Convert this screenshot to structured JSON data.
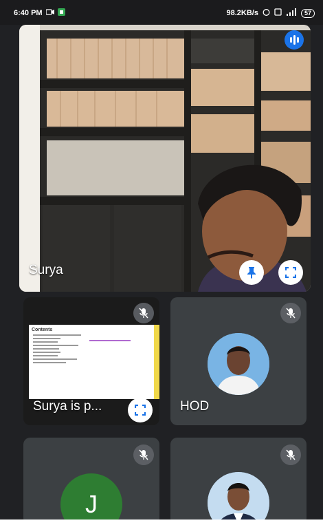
{
  "status_bar": {
    "time": "6:40 PM",
    "network_speed": "98.2KB/s",
    "battery": "57"
  },
  "main_speaker": {
    "name": "Surya"
  },
  "tiles": [
    {
      "name": "Surya is p...",
      "type": "presentation",
      "slide_title": "Contents"
    },
    {
      "name": "HOD",
      "type": "photo"
    },
    {
      "name": "",
      "type": "initial",
      "initial": "J",
      "color": "#2e7d32"
    },
    {
      "name": "",
      "type": "photo"
    }
  ]
}
